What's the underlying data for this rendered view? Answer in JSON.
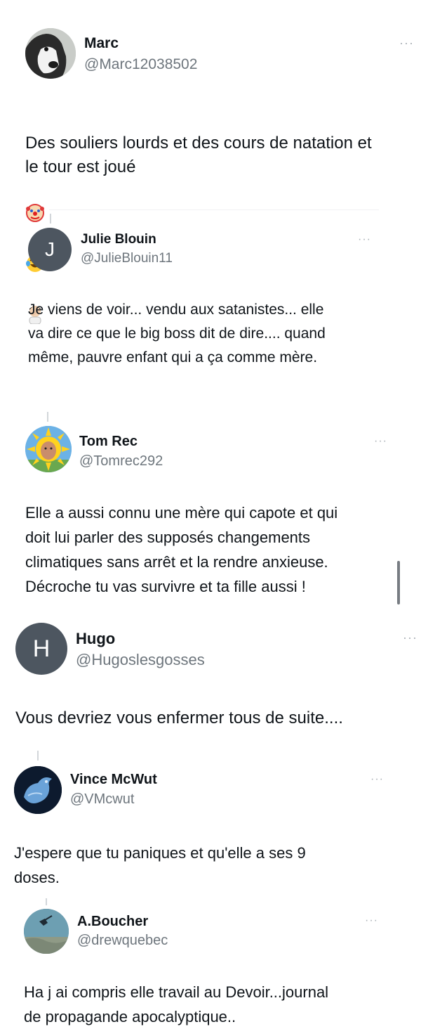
{
  "tweets": [
    {
      "name": "Marc",
      "handle": "@Marc12038502",
      "text": "Des souliers lourds et des cours de natation et\nle tour est joué",
      "emojis": [
        "clown-face",
        "laughing-tears",
        "facepalm"
      ],
      "more": "···"
    },
    {
      "name": "Julie Blouin",
      "handle": "@JulieBlouin11",
      "avatar_letter": "J",
      "text": "Je viens de voir... vendu aux satanistes... elle\nva dire ce que le big boss dit de dire.... quand\nmême, pauvre enfant qui a ça comme mère.",
      "more": "···"
    },
    {
      "name": "Tom Rec",
      "handle": "@Tomrec292",
      "text": "Elle a aussi connu une mère qui capote et qui\ndoit lui parler des supposés changements\nclimatiques sans arrêt et la rendre anxieuse.\nDécroche tu vas survivre et ta fille aussi !",
      "more": "···"
    },
    {
      "name": "Hugo",
      "handle": "@Hugoslesgosses",
      "avatar_letter": "H",
      "text": "Vous devriez vous enfermer tous de suite....",
      "more": "···"
    },
    {
      "name": "Vince McWut",
      "handle": "@VMcwut",
      "text": "J'espere que tu paniques et qu'elle a ses 9\ndoses.",
      "more": "···"
    },
    {
      "name": "A.Boucher",
      "handle": "@drewquebec",
      "text": "Ha j ai compris  elle travail au Devoir...journal\nde propagande apocalyptique..",
      "more": "···"
    }
  ],
  "colors": {
    "text": "#0f1419",
    "handle": "#6e767d",
    "letter_avatar_bg": "#4d5660"
  }
}
